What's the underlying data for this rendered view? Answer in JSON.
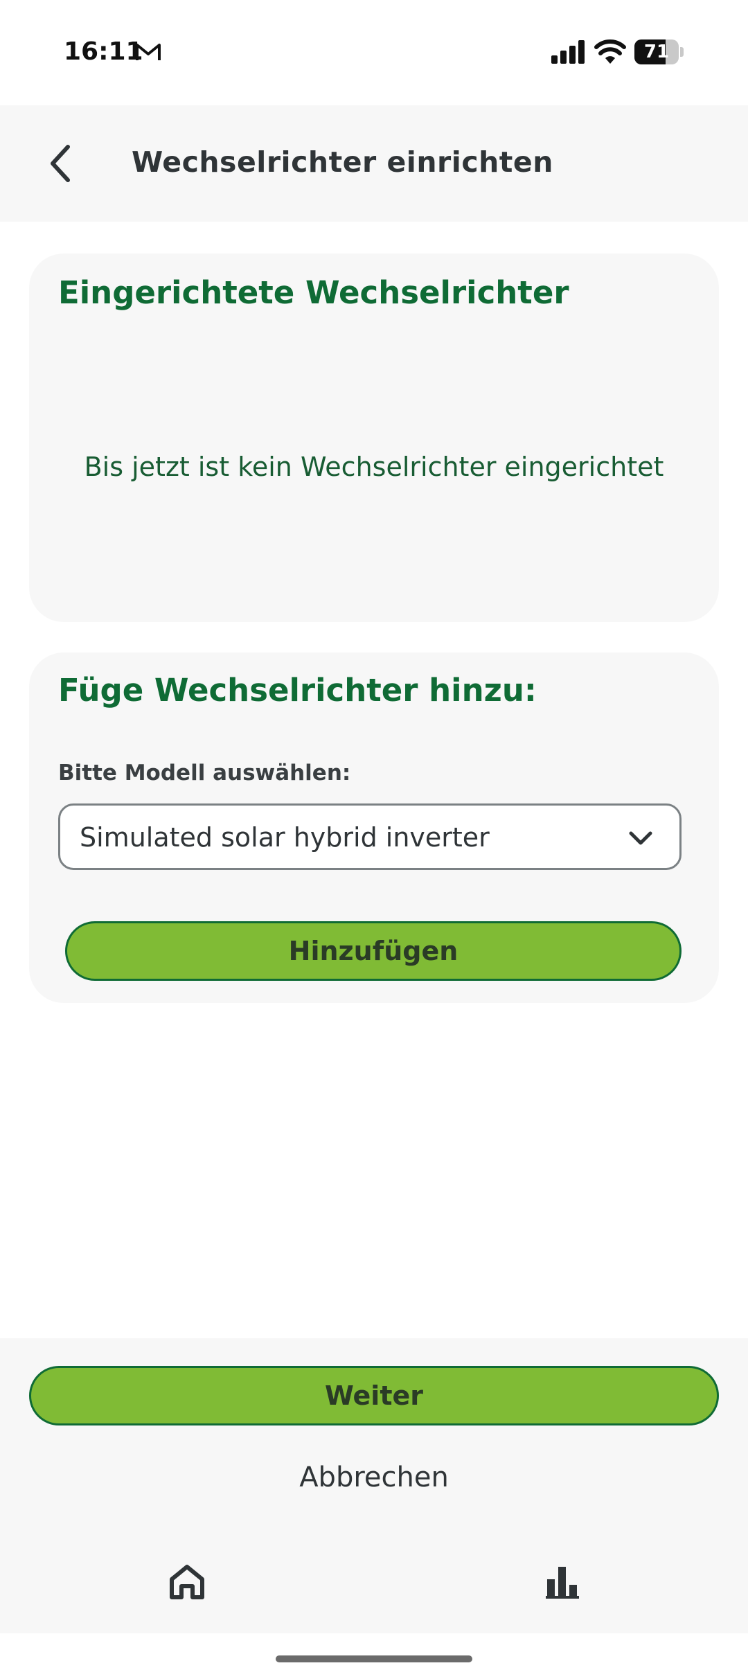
{
  "status_bar": {
    "time": "16:11",
    "battery_level": "71",
    "battery_fraction": 0.71,
    "icons": [
      "gmail-icon",
      "signal-icon",
      "wifi-icon",
      "battery-icon"
    ]
  },
  "app_bar": {
    "title": "Wechselrichter einrichten",
    "back_icon": "chevron-left-icon"
  },
  "installed_card": {
    "heading": "Eingerichtete Wechselrichter",
    "empty_message": "Bis jetzt ist kein Wechselrichter eingerichtet"
  },
  "add_card": {
    "heading": "Füge Wechselrichter hinzu:",
    "select_label": "Bitte Modell auswählen:",
    "selected_model": "Simulated solar hybrid inverter",
    "add_button_label": "Hinzufügen"
  },
  "footer": {
    "next_label": "Weiter",
    "cancel_label": "Abbrechen"
  },
  "bottom_nav": {
    "items": [
      {
        "icon": "home-icon"
      },
      {
        "icon": "bar-chart-icon"
      }
    ]
  },
  "colors": {
    "brand_dark_green": "#0f6b35",
    "accent_green": "#80bb35",
    "panel_gray": "#f7f7f7"
  }
}
